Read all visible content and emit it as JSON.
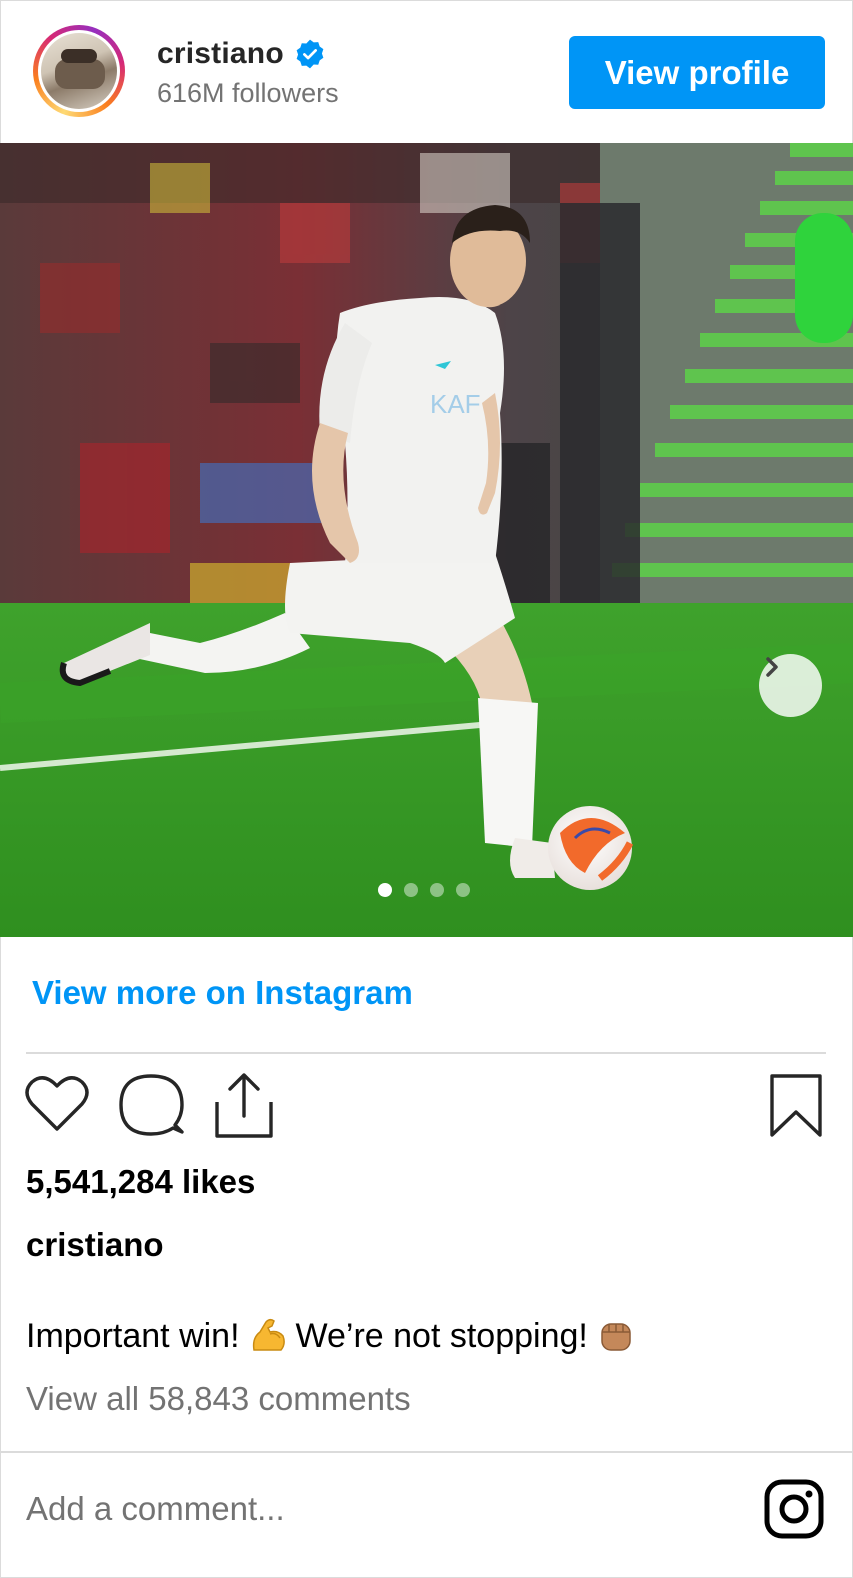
{
  "header": {
    "username": "cristiano",
    "verified": true,
    "followers": "616M followers",
    "view_profile_label": "View profile"
  },
  "post": {
    "carousel": {
      "total_slides": 4,
      "active_slide": 1
    },
    "view_more_label": "View more on Instagram",
    "likes": "5,541,284 likes",
    "caption_user": "cristiano",
    "caption_part1": "Important win!",
    "caption_part2": "We’re not stopping!",
    "caption_emojis": [
      "flexed-biceps",
      "oncoming-fist"
    ],
    "view_comments": "View all 58,843 comments",
    "comment_placeholder": "Add a comment..."
  },
  "icons": {
    "verified": "verified-badge-icon",
    "next": "chevron-right-icon",
    "like": "heart-icon",
    "comment": "comment-icon",
    "share": "share-icon",
    "save": "bookmark-icon",
    "instagram": "instagram-logo-icon"
  },
  "colors": {
    "accent": "#0095f6",
    "secondary_text": "#737373",
    "divider": "#dbdbdb"
  }
}
